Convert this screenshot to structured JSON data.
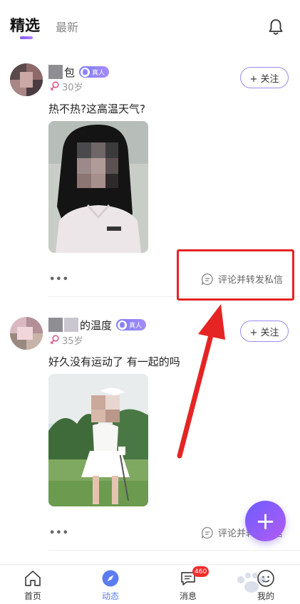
{
  "header": {
    "tabs": [
      {
        "label": "精选",
        "active": true
      },
      {
        "label": "最新",
        "active": false
      }
    ],
    "bell_icon": "bell-icon"
  },
  "posts": [
    {
      "name_suffix": "包",
      "badge": "真人",
      "age": "30岁",
      "follow_label": "+ 关注",
      "text": "热不热?这高温天气?",
      "more": "•••",
      "comment_action": "评论并转发私信"
    },
    {
      "name_suffix": "的温度",
      "badge": "真人",
      "age": "35岁",
      "follow_label": "+ 关注",
      "text": "好久没有运动了 有一起的吗",
      "more": "•••",
      "comment_action": "评论并转发私信"
    }
  ],
  "fab": {
    "label": "+"
  },
  "bottom_nav": {
    "items": [
      {
        "label": "首页",
        "icon": "home-icon",
        "active": false
      },
      {
        "label": "动态",
        "icon": "compass-icon",
        "active": true
      },
      {
        "label": "消息",
        "icon": "message-icon",
        "active": false,
        "badge": "460"
      },
      {
        "label": "我的",
        "icon": "profile-icon",
        "active": false
      }
    ]
  },
  "colors": {
    "accent": "#7b5cff",
    "active_nav": "#5b7cf0",
    "annotation_red": "#e52424",
    "badge_red": "#ee2d2d"
  }
}
